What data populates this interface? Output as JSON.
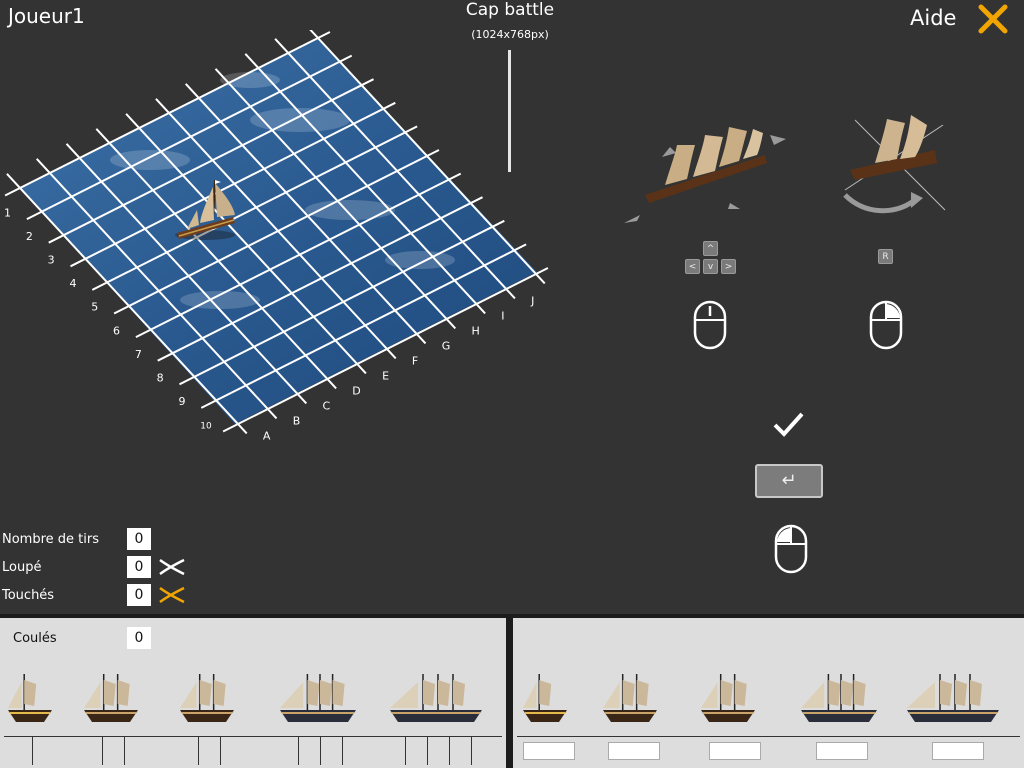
{
  "header": {
    "player_name": "Joueur1",
    "title": "Cap battle",
    "subtitle": "(1024x768px)",
    "help_label": "Aide"
  },
  "board": {
    "row_labels": [
      "1",
      "2",
      "3",
      "4",
      "5",
      "6",
      "7",
      "8",
      "9",
      "10"
    ],
    "col_labels": [
      "A",
      "B",
      "C",
      "D",
      "E",
      "F",
      "G",
      "H",
      "I",
      "J"
    ]
  },
  "controls": {
    "key_up": "^",
    "key_left": "<",
    "key_down": "v",
    "key_right": ">",
    "key_rotate": "R",
    "confirm_key": "↵"
  },
  "stats": {
    "shots_label": "Nombre de tirs",
    "shots_value": "0",
    "missed_label": "Loupé",
    "missed_value": "0",
    "hits_label": "Touchés",
    "hits_value": "0"
  },
  "fleet": {
    "sunk_label": "Coulés",
    "sunk_value": "0",
    "ships": [
      {
        "size": 2
      },
      {
        "size": 3
      },
      {
        "size": 3
      },
      {
        "size": 4
      },
      {
        "size": 5
      }
    ]
  },
  "colors": {
    "background": "#333333",
    "panel": "#dddddd",
    "accent": "#f0a500",
    "water": "#2b5b8f"
  }
}
